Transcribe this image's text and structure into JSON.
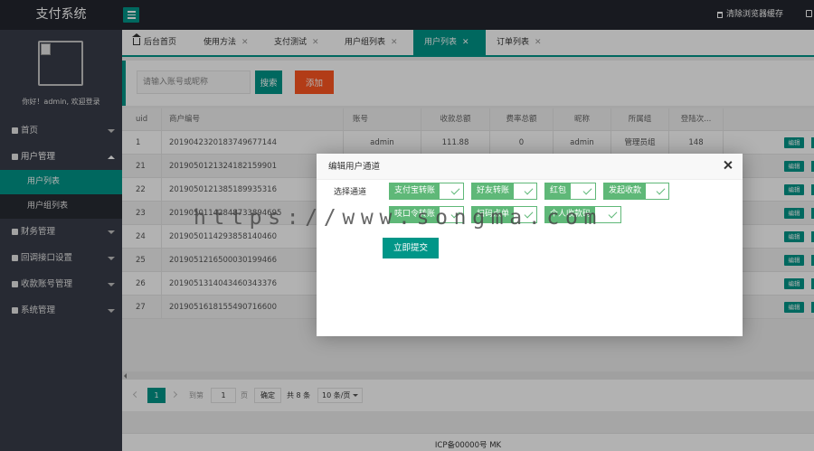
{
  "header": {
    "logo": "支付系统",
    "clear_cache": "清除浏览器缓存"
  },
  "sidebar": {
    "welcome": "你好！admin, 欢迎登录",
    "menu": [
      {
        "label": "首页",
        "icon": "home-icon"
      },
      {
        "label": "用户管理",
        "icon": "user-icon",
        "open": true,
        "children": [
          {
            "label": "用户列表",
            "active": true
          },
          {
            "label": "用户组列表"
          }
        ]
      },
      {
        "label": "财务管理",
        "icon": "list-icon"
      },
      {
        "label": "回调接口设置",
        "icon": "gear-icon"
      },
      {
        "label": "收款账号管理",
        "icon": "users-icon"
      },
      {
        "label": "系统管理",
        "icon": "gear-icon"
      }
    ]
  },
  "tabs": [
    {
      "label": "后台首页",
      "home": true
    },
    {
      "label": "使用方法"
    },
    {
      "label": "支付测试"
    },
    {
      "label": "用户组列表"
    },
    {
      "label": "用户列表",
      "active": true
    },
    {
      "label": "订单列表"
    }
  ],
  "search": {
    "placeholder": "请输入账号或昵称",
    "search_label": "搜索",
    "add_label": "添加"
  },
  "table": {
    "columns": [
      "uid",
      "商户编号",
      "账号",
      "收款总额",
      "费率总额",
      "昵称",
      "所属组",
      "登陆次..."
    ],
    "rows": [
      [
        "1",
        "20190423201837496771​44",
        "admin",
        "111.88",
        "0",
        "admin",
        "管理员组",
        "148"
      ],
      [
        "21",
        "201905012132418215​9901",
        "",
        "",
        "",
        "",
        "",
        ""
      ],
      [
        "22",
        "201905012138518993​5316",
        "",
        "",
        "",
        "",
        "",
        ""
      ],
      [
        "23",
        "201905011428487338​94695",
        "",
        "",
        "",
        "",
        "",
        ""
      ],
      [
        "24",
        "20190501142938581404​60",
        "",
        "",
        "",
        "",
        "",
        ""
      ],
      [
        "25",
        "201905121650003019​9466",
        "",
        "",
        "",
        "",
        "",
        ""
      ],
      [
        "26",
        "201905131404346034​3376",
        "",
        "",
        "",
        "",
        "",
        ""
      ],
      [
        "27",
        "201905161815549071​6600",
        "",
        "",
        "",
        "",
        "",
        ""
      ]
    ],
    "edit_label": "编辑"
  },
  "pager": {
    "current": "1",
    "goto_label": "到第",
    "page_value": "1",
    "page_unit": "页",
    "confirm": "确定",
    "total": "共 8 条",
    "page_size": "10 条/页"
  },
  "footer": {
    "icp": "ICP备00000号 MK"
  },
  "modal": {
    "title": "编辑用户通道",
    "channel_label": "选择通道",
    "channels": [
      "支付宝转账",
      "好友转账",
      "红包",
      "发起收款",
      "吱口令转账",
      "扫码点单",
      "个人收款码"
    ],
    "submit": "立即提交"
  },
  "watermark": "https://www.songma.com",
  "colors": {
    "primary": "#009688",
    "danger": "#ff5722",
    "checked": "#5fb878",
    "sidebar": "#393d49",
    "header": "#23262e"
  }
}
